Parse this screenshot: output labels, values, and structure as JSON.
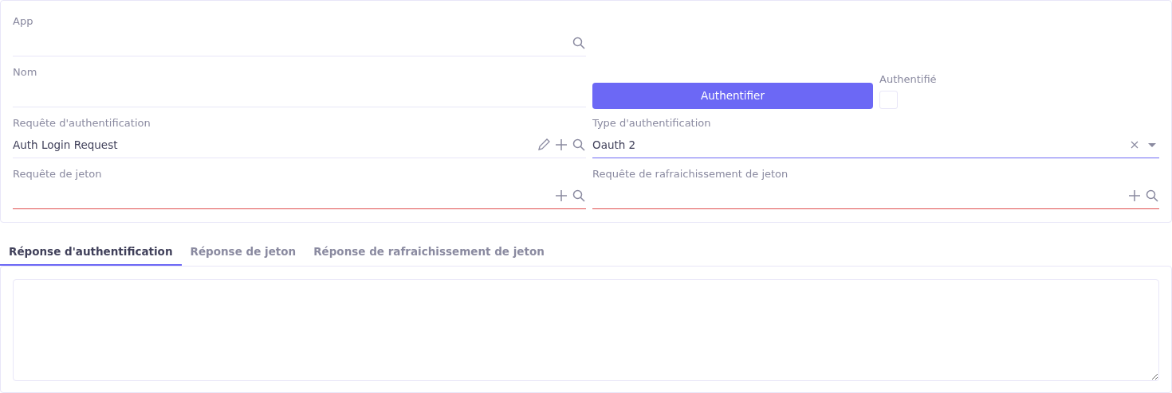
{
  "form": {
    "left": [
      {
        "label": "App",
        "kind": "lookup",
        "invalid": false,
        "focused": false
      },
      {
        "label": "Nom",
        "kind": "text",
        "invalid": false,
        "focused": false
      },
      {
        "label": "Requête d'authentification",
        "value": "Auth Login Request",
        "kind": "lookup-edit",
        "invalid": false,
        "focused": false
      },
      {
        "label": "Requête de jeton",
        "kind": "lookup-create",
        "invalid": true,
        "focused": false
      }
    ],
    "authenticate_button": "Authentifier",
    "authenticated": {
      "label": "Authentifié",
      "checked": false
    },
    "right": [
      {
        "label": "Type d'authentification",
        "value": "Oauth 2",
        "kind": "select",
        "invalid": false,
        "focused": true
      },
      {
        "label": "Requête de rafraichissement de jeton",
        "kind": "lookup-create",
        "invalid": true,
        "focused": false
      }
    ]
  },
  "tabs": [
    {
      "label": "Réponse d'authentification",
      "selected": true
    },
    {
      "label": "Réponse de jeton",
      "selected": false
    },
    {
      "label": "Réponse de rafraichissement de jeton",
      "selected": false
    }
  ],
  "response": {
    "kind": "textarea"
  }
}
